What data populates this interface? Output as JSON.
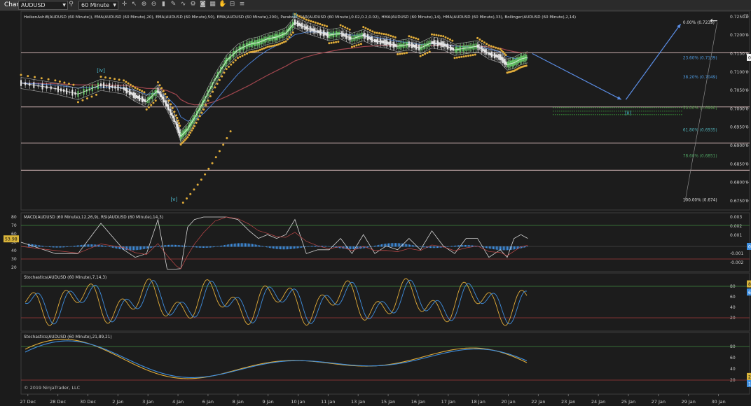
{
  "toolbar": {
    "tab_label": "Chart",
    "symbol": "AUDUSD",
    "timeframe": "60 Minute",
    "icons": [
      "search-icon",
      "crosshair-icon",
      "zoom-in-icon",
      "zoom-out-icon",
      "bar-style-icon",
      "pencil-icon",
      "indicator-icon",
      "camera-icon",
      "layout-icon",
      "hand-icon",
      "lock-icon",
      "properties-icon"
    ]
  },
  "copyright": "© 2019 NinjaTrader, LLC",
  "chart_data": [
    {
      "type": "candlestick",
      "panel": "price",
      "indicator_label": "HeikenAshi8(AUDUSD (60 Minute)), EMA(AUDUSD (60 Minute),20), EMA(AUDUSD (60 Minute),50), EMA(AUDUSD (60 Minute),200), Parabolic SAR(AUDUSD (60 Minute),0.02,0.2,0.02), HMA(AUDUSD (60 Minute),14), HMA(AUDUSD (60 Minute),33), Bollinger(AUDUSD (60 Minute),2,14)",
      "ylim": [
        0.6725,
        0.7265
      ],
      "yticks": [
        "0.7250'0",
        "0.7200'0",
        "0.7150'0",
        "0.7100'0",
        "0.7050'0",
        "0.7000'0",
        "0.6950'0",
        "0.6900'0",
        "0.6850'0",
        "0.6800'0",
        "0.6750'0"
      ],
      "current_price": "0.7139'6",
      "price_series": {
        "x": [
          0,
          1.5,
          2.5,
          3.5,
          4.5,
          5,
          5.5,
          6,
          6.4,
          6.8,
          7.0,
          7.3,
          7.6,
          8,
          8.5,
          9,
          9.5,
          10,
          10.4,
          10.8,
          11.2,
          11.6,
          12,
          12.5,
          13,
          13.5,
          14,
          14.5,
          15,
          15.5,
          16,
          16.5,
          17,
          17.5,
          18,
          18.5,
          19,
          19.5,
          20,
          20.5,
          21,
          21.3,
          21.6,
          21.9,
          22.2
        ],
        "y": [
          0.707,
          0.7055,
          0.704,
          0.7065,
          0.7055,
          0.7035,
          0.702,
          0.705,
          0.701,
          0.696,
          0.6925,
          0.6945,
          0.6975,
          0.702,
          0.708,
          0.713,
          0.716,
          0.7175,
          0.718,
          0.719,
          0.7195,
          0.7205,
          0.7235,
          0.722,
          0.721,
          0.72,
          0.7205,
          0.719,
          0.72,
          0.7185,
          0.718,
          0.717,
          0.7175,
          0.7165,
          0.718,
          0.7175,
          0.716,
          0.7165,
          0.717,
          0.715,
          0.714,
          0.712,
          0.7125,
          0.7135,
          0.714
        ]
      },
      "horizontal_levels": [
        0.7152,
        0.7005,
        0.6907,
        0.6833
      ],
      "wave_labels": [
        {
          "label": "[i]",
          "x": 12,
          "y": 0.725
        },
        {
          "label": "[iv]",
          "x": 3.5,
          "y": 0.71
        },
        {
          "label": "[v]",
          "x": 6.7,
          "y": 0.675
        },
        {
          "label": "[ii]",
          "x": 26.6,
          "y": 0.6985
        }
      ],
      "projection_arrows": [
        {
          "x": [
            22.4,
            26.3
          ],
          "y": [
            0.715,
            0.7025
          ]
        },
        {
          "x": [
            26.5,
            28.9
          ],
          "y": [
            0.7025,
            0.723
          ]
        }
      ],
      "fibonacci": [
        {
          "label": "0.00% (0.7235)",
          "value": 0.7235
        },
        {
          "label": "23.60% (0.7139)",
          "value": 0.7139
        },
        {
          "label": "38.20% (0.7049)",
          "value": 0.7086
        },
        {
          "label": "50.00% (0.6990)",
          "value": 0.7003
        },
        {
          "label": "61.80% (0.6935)",
          "value": 0.6943
        },
        {
          "label": "78.60% (0.6851)",
          "value": 0.6872
        },
        {
          "label": "100.00% (0.674)",
          "value": 0.6753
        }
      ]
    },
    {
      "type": "line",
      "panel": "macd_rsi",
      "indicator_label": "MACD(AUDUSD (60 Minute),12,26,9), RSI(AUDUSD (60 Minute),14,3)",
      "left_ticks": [
        "80",
        "70",
        "60",
        "50",
        "40",
        "30",
        "20"
      ],
      "right_ticks": [
        "0.003",
        "0.002",
        "0.001",
        "-0.001",
        "-0.002"
      ],
      "rsi_value": "53.98",
      "macd_value": "0.0000890",
      "rsi_levels": [
        70,
        30
      ],
      "ylim": [
        15,
        85
      ]
    },
    {
      "type": "line",
      "panel": "stochastics_fast",
      "indicator_label": "Stochastics(AUDUSD (60 Minute),7,14,3)",
      "ticks": [
        "80",
        "60",
        "40",
        "20"
      ],
      "value_k": "84.62",
      "value_d": "69",
      "levels": [
        80,
        20
      ],
      "ylim": [
        0,
        100
      ]
    },
    {
      "type": "line",
      "panel": "stochastics_slow",
      "indicator_label": "Stochastics(AUDUSD (60 Minute),21,89,21)",
      "ticks": [
        "80",
        "60",
        "40",
        "20"
      ],
      "value_k": "26.42",
      "value_d": "13.89",
      "levels": [
        80,
        20
      ],
      "ylim": [
        0,
        100
      ]
    }
  ],
  "x_axis": {
    "labels": [
      "27 Dec",
      "28 Dec",
      "30 Dec",
      "2 Jan",
      "3 Jan",
      "4 Jan",
      "6 Jan",
      "8 Jan",
      "9 Jan",
      "10 Jan",
      "11 Jan",
      "13 Jan",
      "15 Jan",
      "16 Jan",
      "17 Jan",
      "18 Jan",
      "20 Jan",
      "22 Jan",
      "23 Jan",
      "24 Jan",
      "25 Jan",
      "27 Jan",
      "29 Jan",
      "30 Jan"
    ],
    "range": [
      0,
      31
    ]
  }
}
